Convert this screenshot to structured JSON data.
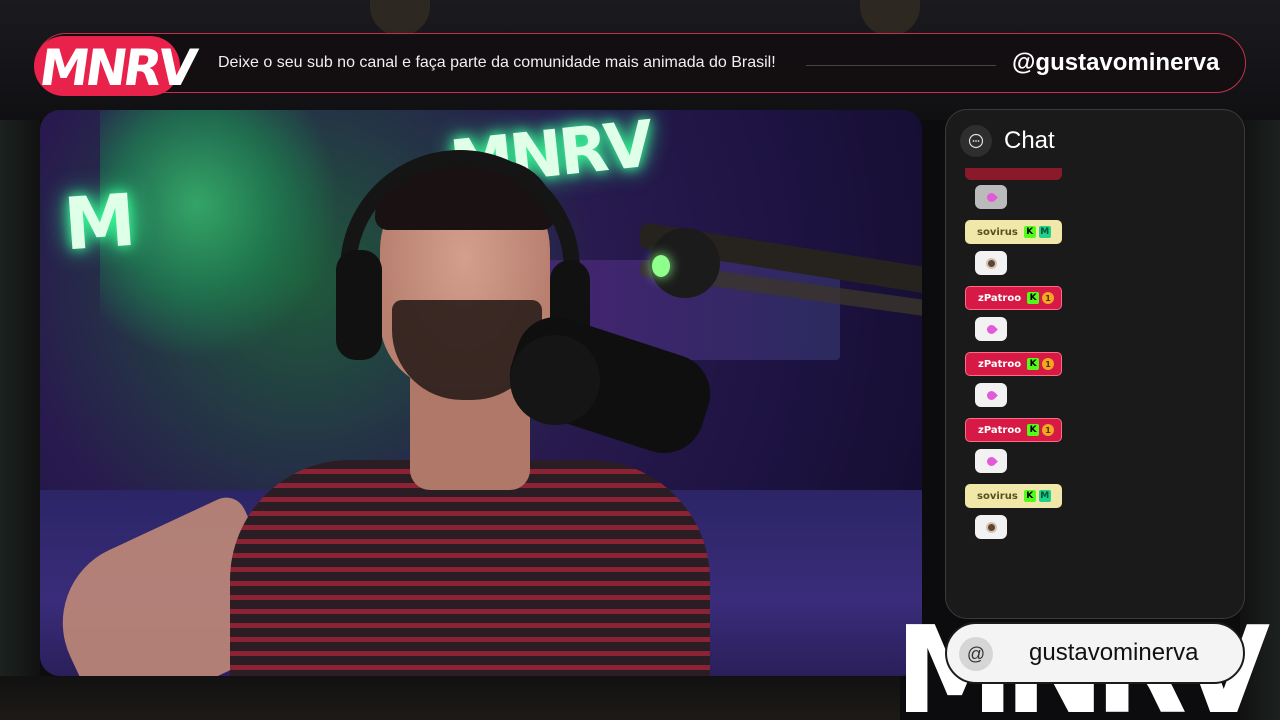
{
  "banner": {
    "logo": "MNRV",
    "message": "Deixe o seu sub no canal e faça parte da comunidade mais animada do Brasil!",
    "handle": "@gustavominerva"
  },
  "camera": {
    "neon_sign": "MNRV",
    "neon_m": "M"
  },
  "chat": {
    "title": "Chat",
    "icon": "chat-bubble-icon",
    "messages": [
      {
        "user": "sovirus",
        "color": "yellow",
        "badges": [
          "kick",
          "mod"
        ],
        "emote": "face"
      },
      {
        "user": "zPatroo",
        "color": "red",
        "badges": [
          "kick",
          "sub"
        ],
        "emote": "rocket"
      },
      {
        "user": "zPatroo",
        "color": "red",
        "badges": [
          "kick",
          "sub"
        ],
        "emote": "rocket"
      },
      {
        "user": "zPatroo",
        "color": "red",
        "badges": [
          "kick",
          "sub"
        ],
        "emote": "rocket"
      },
      {
        "user": "sovirus",
        "color": "yellow",
        "badges": [
          "kick",
          "mod"
        ],
        "emote": "face"
      }
    ],
    "badge_kick": "K",
    "badge_sub": "1",
    "badge_mod": "M"
  },
  "footer": {
    "at": "@",
    "handle": "gustavominerva",
    "big_logo": "MNRV"
  },
  "colors": {
    "brand_red": "#e8224a",
    "chat_bg": "#1a1a1a",
    "kick_green": "#53fc18"
  }
}
